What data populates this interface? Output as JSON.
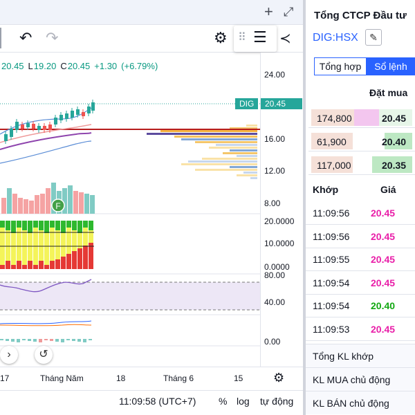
{
  "chart_header": {
    "ohlc": [
      {
        "key": "",
        "value": "20.45"
      },
      {
        "key": "L",
        "value": "19.20"
      },
      {
        "key": "C",
        "value": "20.45"
      },
      {
        "key": "",
        "value": "+1.30"
      },
      {
        "key": "",
        "value": "(+6.79%)"
      }
    ]
  },
  "icons": {
    "add": "+",
    "fullscreen": "⤢",
    "undo": "↶",
    "redo": "↷",
    "settings": "⚙",
    "grip": "⠿",
    "menu": "☰",
    "share": "≺",
    "scroll_right": "›",
    "reset": "↺",
    "axis_settings": "⚙",
    "edit": "✎"
  },
  "price_scale": {
    "main_ticks": [
      "24.00",
      "16.00",
      "12.00",
      "8.00"
    ],
    "last_symbol": "DIG",
    "last_price": "20.45",
    "osc1_ticks": [
      "20.0000",
      "10.0000",
      "0.0000"
    ],
    "osc2_ticks": [
      "80.00",
      "40.00"
    ],
    "osc3_ticks": [
      "0.00"
    ]
  },
  "time_axis": {
    "ticks": [
      "17",
      "Tháng Năm",
      "18",
      "Tháng 6",
      "15"
    ]
  },
  "status_bar": {
    "time": "11:09:58 (UTC+7)",
    "percent": "%",
    "log": "log",
    "auto": "tự động"
  },
  "indicator_marker": "F",
  "book": {
    "company_name": "Tổng CTCP Đầu tư",
    "ticker": "DIG:HSX",
    "tabs": {
      "general": "Tổng hợp",
      "orders": "Sổ lệnh"
    },
    "buy_header": "Đặt mua",
    "bids": [
      {
        "volume": "174,800",
        "price": "20.45"
      },
      {
        "volume": "61,900",
        "price": "20.40"
      },
      {
        "volume": "117,000",
        "price": "20.35"
      }
    ],
    "match_headers": {
      "time": "Khớp",
      "price": "Giá"
    },
    "matches": [
      {
        "time": "11:09:56",
        "price": "20.45",
        "color": "#e91ea8"
      },
      {
        "time": "11:09:56",
        "price": "20.45",
        "color": "#e91ea8"
      },
      {
        "time": "11:09:55",
        "price": "20.45",
        "color": "#e91ea8"
      },
      {
        "time": "11:09:54",
        "price": "20.45",
        "color": "#e91ea8"
      },
      {
        "time": "11:09:54",
        "price": "20.40",
        "color": "#12a812"
      },
      {
        "time": "11:09:53",
        "price": "20.45",
        "color": "#e91ea8"
      }
    ],
    "summary": [
      "Tổng KL khớp",
      "KL MUA chủ động",
      "KL BÁN chủ động"
    ]
  },
  "colors": {
    "up": "#26a69a",
    "down": "#ef5350",
    "accent": "#2962ff",
    "ceiling_pink": "#e91ea8",
    "ref_green": "#12a812"
  }
}
